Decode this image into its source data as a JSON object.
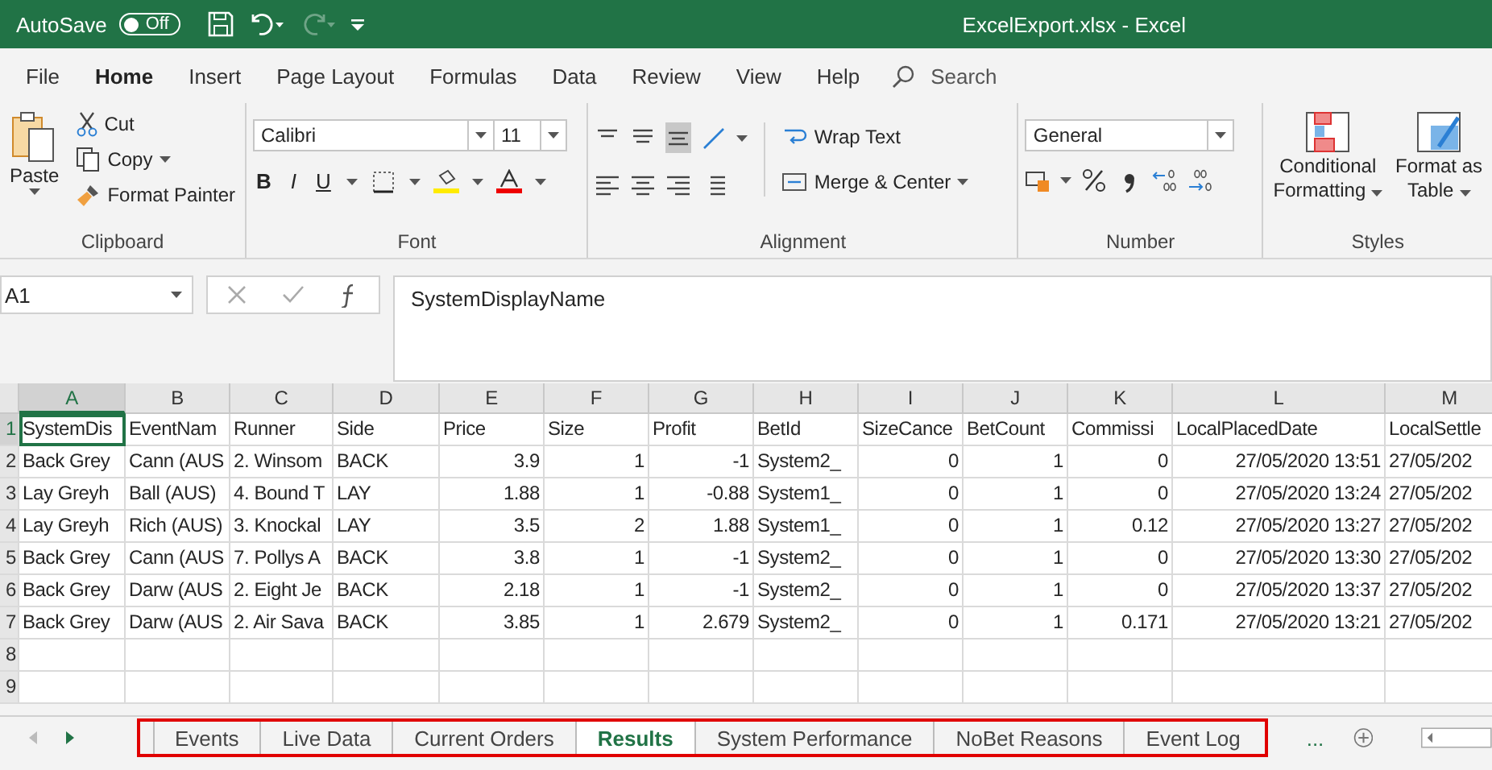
{
  "title_bar": {
    "autosave_label": "AutoSave",
    "autosave_toggle": {
      "label": "Off",
      "on": false
    },
    "redo_disabled": true,
    "title": "ExcelExport.xlsx  -  Excel"
  },
  "menu_tabs": [
    {
      "label": "File",
      "selected": false
    },
    {
      "label": "Home",
      "selected": true
    },
    {
      "label": "Insert",
      "selected": false
    },
    {
      "label": "Page Layout",
      "selected": false
    },
    {
      "label": "Formulas",
      "selected": false
    },
    {
      "label": "Data",
      "selected": false
    },
    {
      "label": "Review",
      "selected": false
    },
    {
      "label": "View",
      "selected": false
    },
    {
      "label": "Help",
      "selected": false
    }
  ],
  "search": {
    "placeholder": "Search"
  },
  "ribbon": {
    "clipboard": {
      "label": "Clipboard",
      "paste": "Paste",
      "cut": "Cut",
      "copy": "Copy",
      "format_painter": "Format Painter"
    },
    "font": {
      "label": "Font",
      "font_name": "Calibri",
      "font_size": "11",
      "bold": "B",
      "italic": "I",
      "underline": "U"
    },
    "alignment": {
      "label": "Alignment",
      "wrap_text": "Wrap Text",
      "merge_center": "Merge & Center"
    },
    "number": {
      "label": "Number",
      "format": "General"
    },
    "styles": {
      "label": "Styles",
      "conditional": [
        "Conditional",
        "Formatting"
      ],
      "format_table": [
        "Format as",
        "Table"
      ]
    }
  },
  "formula_bar": {
    "name_box": "A1",
    "formula": "SystemDisplayName"
  },
  "sheet": {
    "columns": [
      {
        "letter": "A",
        "kind": "text",
        "selected": true
      },
      {
        "letter": "B",
        "kind": "text",
        "selected": false
      },
      {
        "letter": "C",
        "kind": "text",
        "selected": false
      },
      {
        "letter": "D",
        "kind": "text",
        "selected": false
      },
      {
        "letter": "E",
        "kind": "number",
        "selected": false
      },
      {
        "letter": "F",
        "kind": "number",
        "selected": false
      },
      {
        "letter": "G",
        "kind": "number",
        "selected": false
      },
      {
        "letter": "H",
        "kind": "text",
        "selected": false
      },
      {
        "letter": "I",
        "kind": "number",
        "selected": false
      },
      {
        "letter": "J",
        "kind": "number",
        "selected": false
      },
      {
        "letter": "K",
        "kind": "number",
        "selected": false
      },
      {
        "letter": "L",
        "kind": "number",
        "selected": false
      },
      {
        "letter": "M",
        "kind": "text",
        "selected": false
      }
    ],
    "rows": [
      {
        "number": "1",
        "header": true,
        "cells": [
          "SystemDis",
          "EventNam",
          "Runner",
          "Side",
          "Price",
          "Size",
          "Profit",
          "BetId",
          "SizeCance",
          "BetCount",
          "Commissi",
          "LocalPlacedDate",
          "LocalSettle"
        ]
      },
      {
        "number": "2",
        "header": false,
        "cells": [
          "Back Grey",
          "Cann (AUS",
          "2. Winsom",
          "BACK",
          "3.9",
          "1",
          "-1",
          "System2_",
          "0",
          "1",
          "0",
          "27/05/2020 13:51",
          "27/05/202"
        ]
      },
      {
        "number": "3",
        "header": false,
        "cells": [
          "Lay Greyh",
          "Ball (AUS)",
          "4. Bound T",
          "LAY",
          "1.88",
          "1",
          "-0.88",
          "System1_",
          "0",
          "1",
          "0",
          "27/05/2020 13:24",
          "27/05/202"
        ]
      },
      {
        "number": "4",
        "header": false,
        "cells": [
          "Lay Greyh",
          "Rich (AUS)",
          "3. Knockal",
          "LAY",
          "3.5",
          "2",
          "1.88",
          "System1_",
          "0",
          "1",
          "0.12",
          "27/05/2020 13:27",
          "27/05/202"
        ]
      },
      {
        "number": "5",
        "header": false,
        "cells": [
          "Back Grey",
          "Cann (AUS",
          "7. Pollys A",
          "BACK",
          "3.8",
          "1",
          "-1",
          "System2_",
          "0",
          "1",
          "0",
          "27/05/2020 13:30",
          "27/05/202"
        ]
      },
      {
        "number": "6",
        "header": false,
        "cells": [
          "Back Grey",
          "Darw (AUS",
          "2. Eight Je",
          "BACK",
          "2.18",
          "1",
          "-1",
          "System2_",
          "0",
          "1",
          "0",
          "27/05/2020 13:37",
          "27/05/202"
        ]
      },
      {
        "number": "7",
        "header": false,
        "cells": [
          "Back Grey",
          "Darw (AUS",
          "2. Air Sava",
          "BACK",
          "3.85",
          "1",
          "2.679",
          "System2_",
          "0",
          "1",
          "0.171",
          "27/05/2020 13:21",
          "27/05/202"
        ]
      },
      {
        "number": "8",
        "header": false,
        "cells": []
      },
      {
        "number": "9",
        "header": false,
        "cells": []
      }
    ]
  },
  "sheet_tabs": [
    {
      "label": "Events",
      "selected": false
    },
    {
      "label": "Live Data",
      "selected": false
    },
    {
      "label": "Current Orders",
      "selected": false
    },
    {
      "label": "Results",
      "selected": true
    },
    {
      "label": "System Performance",
      "selected": false
    },
    {
      "label": "NoBet Reasons",
      "selected": false
    },
    {
      "label": "Event Log",
      "selected": false
    }
  ],
  "more_sheets": "..."
}
